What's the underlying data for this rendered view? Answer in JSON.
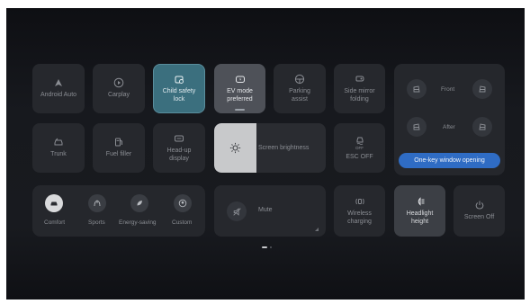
{
  "tiles": {
    "android_auto": "Android Auto",
    "carplay": "Carplay",
    "child_lock_line1": "Child safety",
    "child_lock_line2": "lock",
    "ev_mode_line1": "EV mode",
    "ev_mode_line2": "preferred",
    "parking_line1": "Parking",
    "parking_line2": "assist",
    "mirror_line1": "Side mirror",
    "mirror_line2": "folding",
    "trunk": "Trunk",
    "fuel": "Fuel filler",
    "hud_line1": "Head-up",
    "hud_line2": "display",
    "brightness": "Screen brightness",
    "esc_badge": "OFF",
    "esc": "ESC OFF",
    "mute": "Mute",
    "wireless_line1": "Wireless",
    "wireless_line2": "charging",
    "headlight_line1": "Headlight",
    "headlight_line2": "height",
    "screen_off": "Screen Off"
  },
  "windows": {
    "front": "Front",
    "after": "After",
    "one_key": "One-key window opening"
  },
  "drive_modes": [
    "Comfort",
    "Sports",
    "Energy-saving",
    "Custom"
  ],
  "colors": {
    "accent_blue": "#2f6cc4",
    "active_teal": "#3b6f7e",
    "tile_bg": "#26282d"
  }
}
